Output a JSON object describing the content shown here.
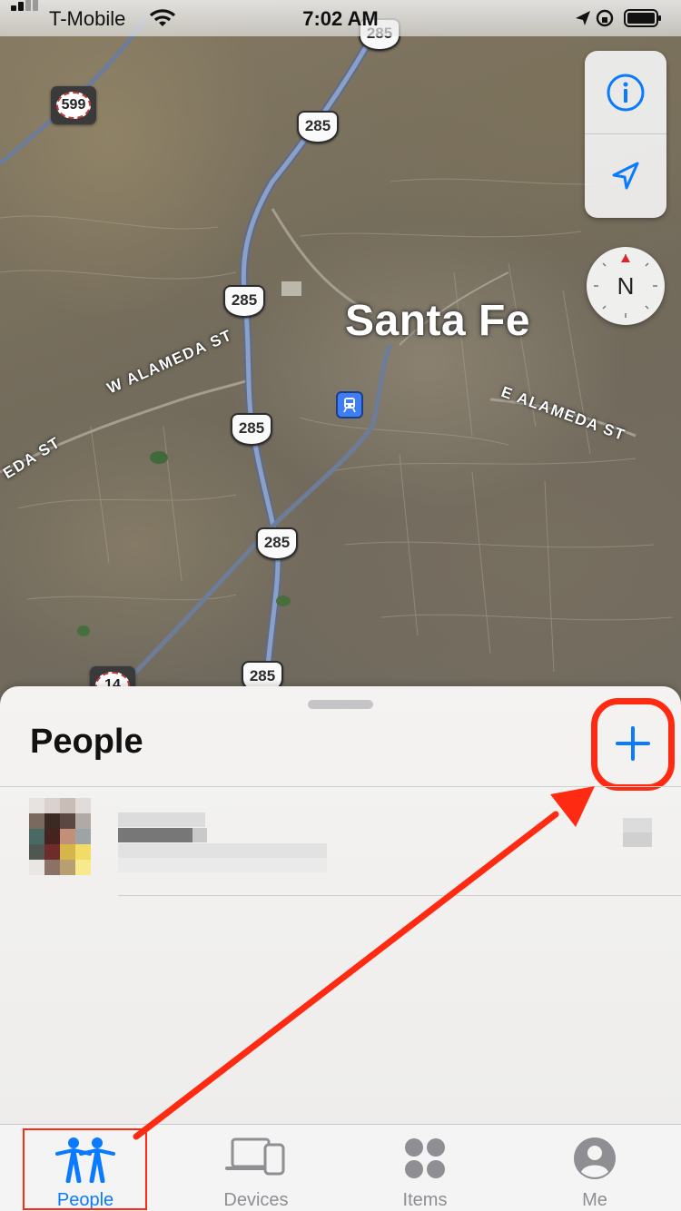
{
  "status_bar": {
    "carrier": "T-Mobile",
    "time": "7:02 AM"
  },
  "map": {
    "city": "Santa Fe",
    "streets": [
      "W ALAMEDA ST",
      "E ALAMEDA ST",
      "EDA ST"
    ],
    "route_shields": [
      "285",
      "285",
      "285",
      "285",
      "285",
      "285"
    ],
    "state_shields": [
      "599",
      "14"
    ],
    "compass": "N",
    "controls": [
      "info-icon",
      "location-arrow-icon"
    ]
  },
  "sheet": {
    "title": "People",
    "add_icon": "plus-icon",
    "accent": "#0a7aff",
    "highlight_color": "#ff2a12"
  },
  "tabs": [
    {
      "label": "People",
      "icon": "people-icon",
      "active": true
    },
    {
      "label": "Devices",
      "icon": "devices-icon",
      "active": false
    },
    {
      "label": "Items",
      "icon": "items-icon",
      "active": false
    },
    {
      "label": "Me",
      "icon": "me-icon",
      "active": false
    }
  ]
}
